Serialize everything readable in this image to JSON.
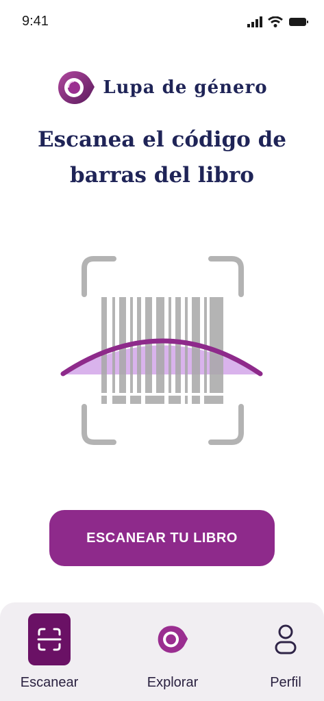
{
  "status_bar": {
    "time": "9:41",
    "icons": [
      "signal-icon",
      "wifi-icon",
      "battery-icon"
    ]
  },
  "header": {
    "app_name": "Lupa de género",
    "logo_icon": "magnifier-drop-logo"
  },
  "main": {
    "headline_line1": "Escanea el código de",
    "headline_line2": "barras del libro",
    "scanner_icon": "barcode-scan-frame",
    "scan_button_label": "ESCANEAR TU LIBRO"
  },
  "nav": {
    "items": [
      {
        "label": "Escanear",
        "icon": "scan-frame-icon",
        "active": true
      },
      {
        "label": "Explorar",
        "icon": "magnifier-drop-icon",
        "active": false
      },
      {
        "label": "Perfil",
        "icon": "person-icon",
        "active": false
      }
    ]
  },
  "colors": {
    "primary": "#8e2a8b",
    "primary_dark": "#6a1165",
    "text_dark": "#1f2457",
    "lens_fill": "#d9b3ec",
    "barcode_gray": "#a8a8a8",
    "nav_bg": "#f1eef2"
  }
}
